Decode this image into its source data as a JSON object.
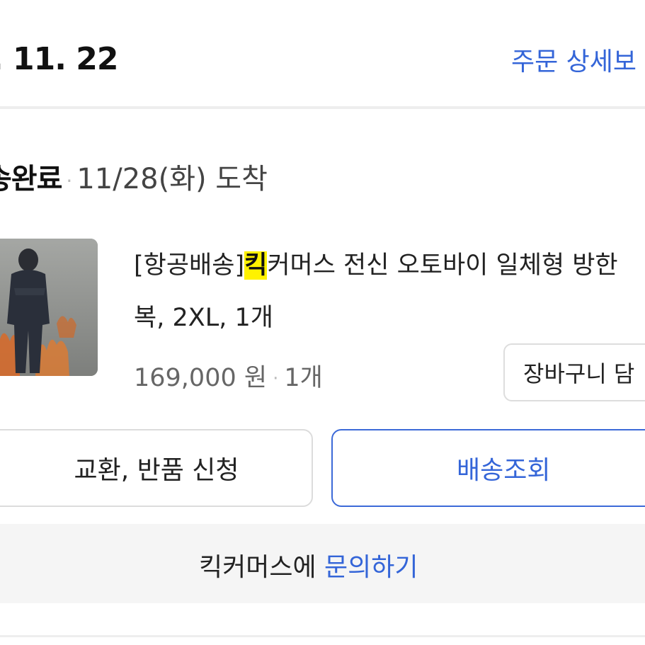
{
  "header": {
    "order_date": ". 11. 22",
    "detail_link": "주문 상세보"
  },
  "shipment": {
    "status": "송완료",
    "separator": "·",
    "arrival": "11/28(화) 도착"
  },
  "product": {
    "title_prefix": "[항공배송]",
    "title_highlight": "킥",
    "title_rest": "커머스 전신 오토바이 일체형 방한",
    "title_line2": "복, 2XL, 1개",
    "price": "169,000 원",
    "price_separator": "·",
    "quantity": "1개",
    "cart_button": "장바구니 담"
  },
  "actions": {
    "exchange_return": "교환, 반품 신청",
    "tracking": "배송조회"
  },
  "inquiry": {
    "seller_prefix": "킥커머스에 ",
    "link": "문의하기"
  },
  "colors": {
    "accent": "#3465d8",
    "highlight": "#fff200",
    "divider": "#eeeeee",
    "inquiry_bg": "#f5f5f5"
  }
}
